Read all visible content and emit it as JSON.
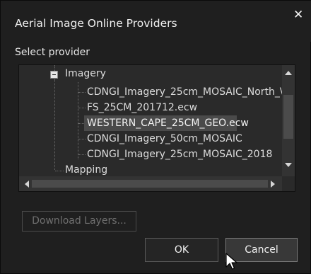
{
  "dialog": {
    "title": "Aerial Image Online Providers",
    "close_glyph": "✕"
  },
  "section_label": "Select provider",
  "tree": {
    "group_label": "Imagery",
    "items": [
      {
        "label": "CDNGI_Imagery_25cm_MOSAIC_North_\\"
      },
      {
        "label": "FS_25CM_201712.ecw"
      },
      {
        "label": "WESTERN_CAPE_25CM_GEO.ecw",
        "selected": true
      },
      {
        "label": "CDNGI_Imagery_50cm_MOSAIC"
      },
      {
        "label": "CDNGI_Imagery_25cm_MOSAIC_2018"
      }
    ],
    "next_group_label": "Mapping"
  },
  "buttons": {
    "download": "Download Layers...",
    "ok": "OK",
    "cancel": "Cancel"
  },
  "icons": {
    "close": "close-icon",
    "collapse": "minus-box-icon",
    "scroll_up": "triangle-up-icon",
    "scroll_down": "triangle-down-icon",
    "scroll_left": "triangle-left-icon",
    "scroll_right": "triangle-right-icon",
    "cursor": "mouse-pointer-icon"
  }
}
